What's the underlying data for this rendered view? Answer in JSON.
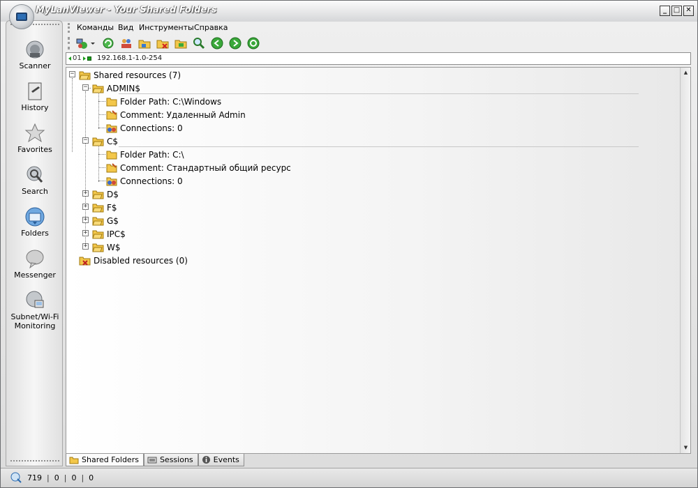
{
  "window": {
    "title": "MyLanViewer - Your Shared Folders",
    "buttons": {
      "minimize": "_",
      "maximize": "□",
      "close": "✕"
    }
  },
  "sidebar": {
    "items": [
      {
        "label": "Scanner",
        "icon": "scanner-icon"
      },
      {
        "label": "History",
        "icon": "history-icon"
      },
      {
        "label": "Favorites",
        "icon": "star-icon"
      },
      {
        "label": "Search",
        "icon": "search-icon"
      },
      {
        "label": "Folders",
        "icon": "folders-icon"
      },
      {
        "label": "Messenger",
        "icon": "messenger-icon"
      },
      {
        "label": "Subnet/Wi-Fi",
        "label2": "Monitoring",
        "icon": "monitoring-icon"
      }
    ]
  },
  "menu": {
    "items": [
      "Команды",
      "Вид",
      "Инструменты",
      "Справка"
    ]
  },
  "toolbar": {
    "icons": [
      "computers-icon",
      "dropdown-arrow-icon",
      "refresh-icon",
      "users-icon",
      "folder-icon",
      "folder-delete-icon",
      "folder-open-icon",
      "search-icon",
      "back-icon",
      "forward-icon",
      "reload-icon"
    ]
  },
  "address": {
    "prefix": "01",
    "value": "192.168.1-1.0-254"
  },
  "tree": {
    "root_label": "Shared resources (7)",
    "shares": [
      {
        "name": "ADMIN$",
        "expanded": true,
        "children": [
          {
            "type": "path",
            "label": "Folder Path: C:\\Windows"
          },
          {
            "type": "comment",
            "label": "Comment: Удаленный Admin"
          },
          {
            "type": "connections",
            "label": "Connections: 0"
          }
        ]
      },
      {
        "name": "C$",
        "expanded": true,
        "children": [
          {
            "type": "path",
            "label": "Folder Path: C:\\"
          },
          {
            "type": "comment",
            "label": "Comment: Стандартный общий ресурс"
          },
          {
            "type": "connections",
            "label": "Connections: 0"
          }
        ]
      },
      {
        "name": "D$",
        "expanded": false
      },
      {
        "name": "F$",
        "expanded": false
      },
      {
        "name": "G$",
        "expanded": false
      },
      {
        "name": "IPC$",
        "expanded": false
      },
      {
        "name": "W$",
        "expanded": false
      }
    ],
    "disabled_label": "Disabled resources (0)"
  },
  "tabs": [
    {
      "label": "Shared Folders",
      "icon": "shared-folder-icon",
      "active": true
    },
    {
      "label": "Sessions",
      "icon": "sessions-icon",
      "active": false
    },
    {
      "label": "Events",
      "icon": "info-icon",
      "active": false
    }
  ],
  "status": {
    "fields": [
      "719",
      "0",
      "0",
      "0"
    ]
  },
  "colors": {
    "title_text": "#ffffff",
    "folder": "#f3c74a",
    "nav_green": "#3aa83a"
  }
}
